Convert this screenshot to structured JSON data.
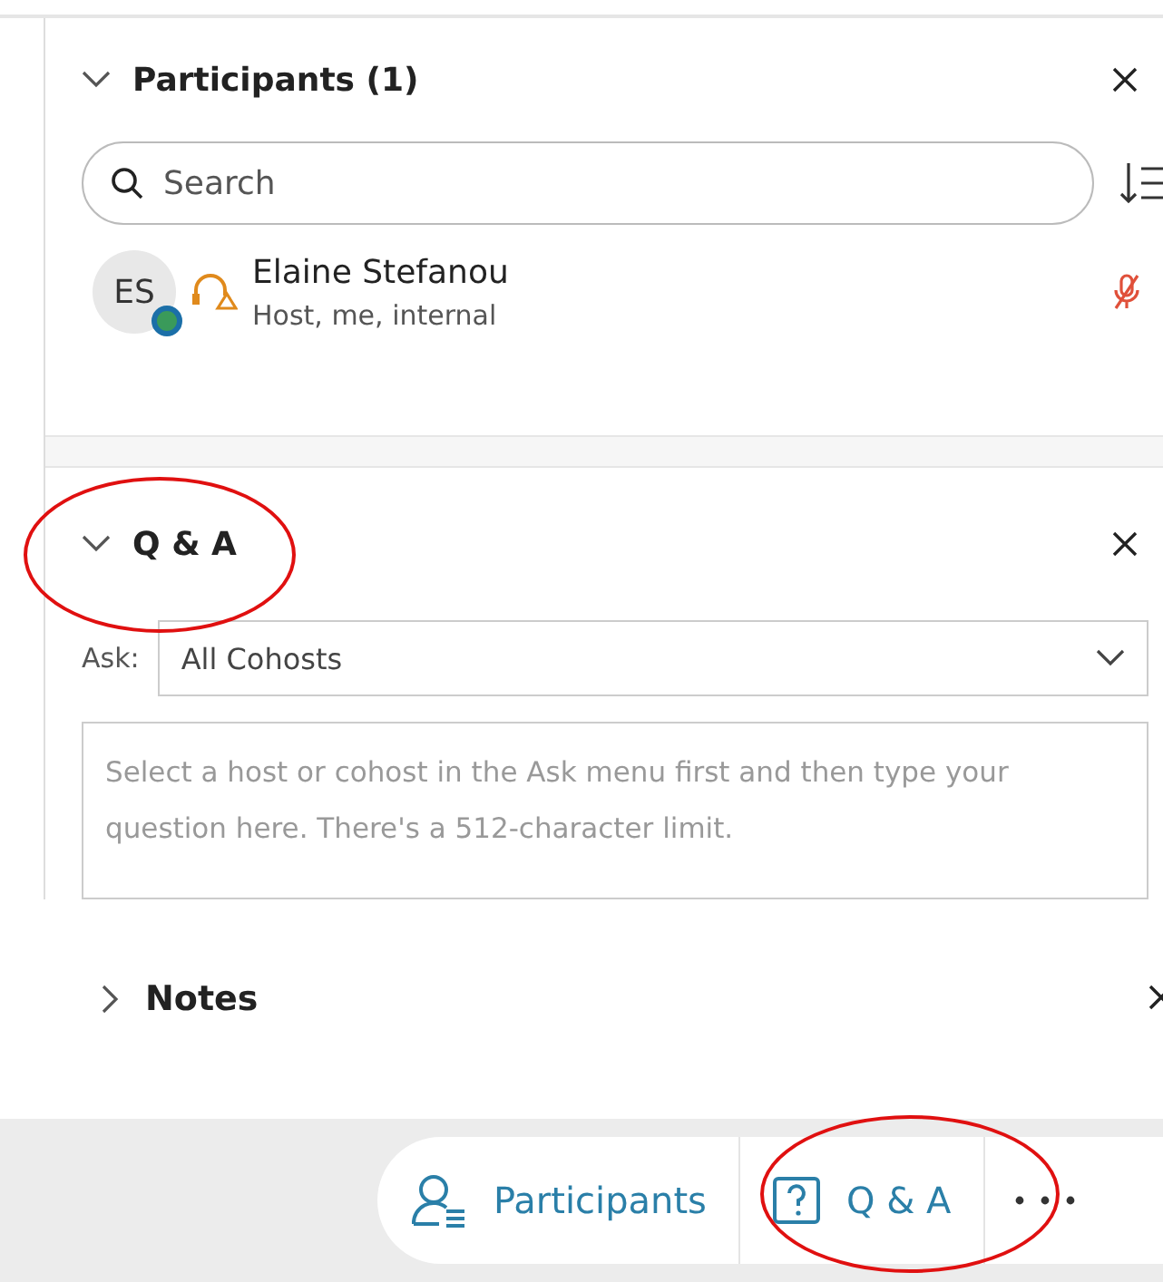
{
  "participants_panel": {
    "title": "Participants (1)",
    "expanded": true,
    "search": {
      "placeholder": "Search"
    },
    "participants": [
      {
        "initials": "ES",
        "name": "Elaine Stefanou",
        "role": "Host, me, internal",
        "muted": true
      }
    ]
  },
  "qa_panel": {
    "title": "Q & A",
    "expanded": true,
    "ask_label": "Ask:",
    "ask_value": "All Cohosts",
    "question": {
      "placeholder": "Select a host or cohost in the Ask menu first and then type your question here. There's a 512-character limit."
    }
  },
  "notes_panel": {
    "title": "Notes",
    "expanded": false
  },
  "toolbar": {
    "buttons": [
      {
        "kind": "participants",
        "label": "Participants"
      },
      {
        "kind": "qa",
        "label": "Q & A"
      }
    ]
  }
}
